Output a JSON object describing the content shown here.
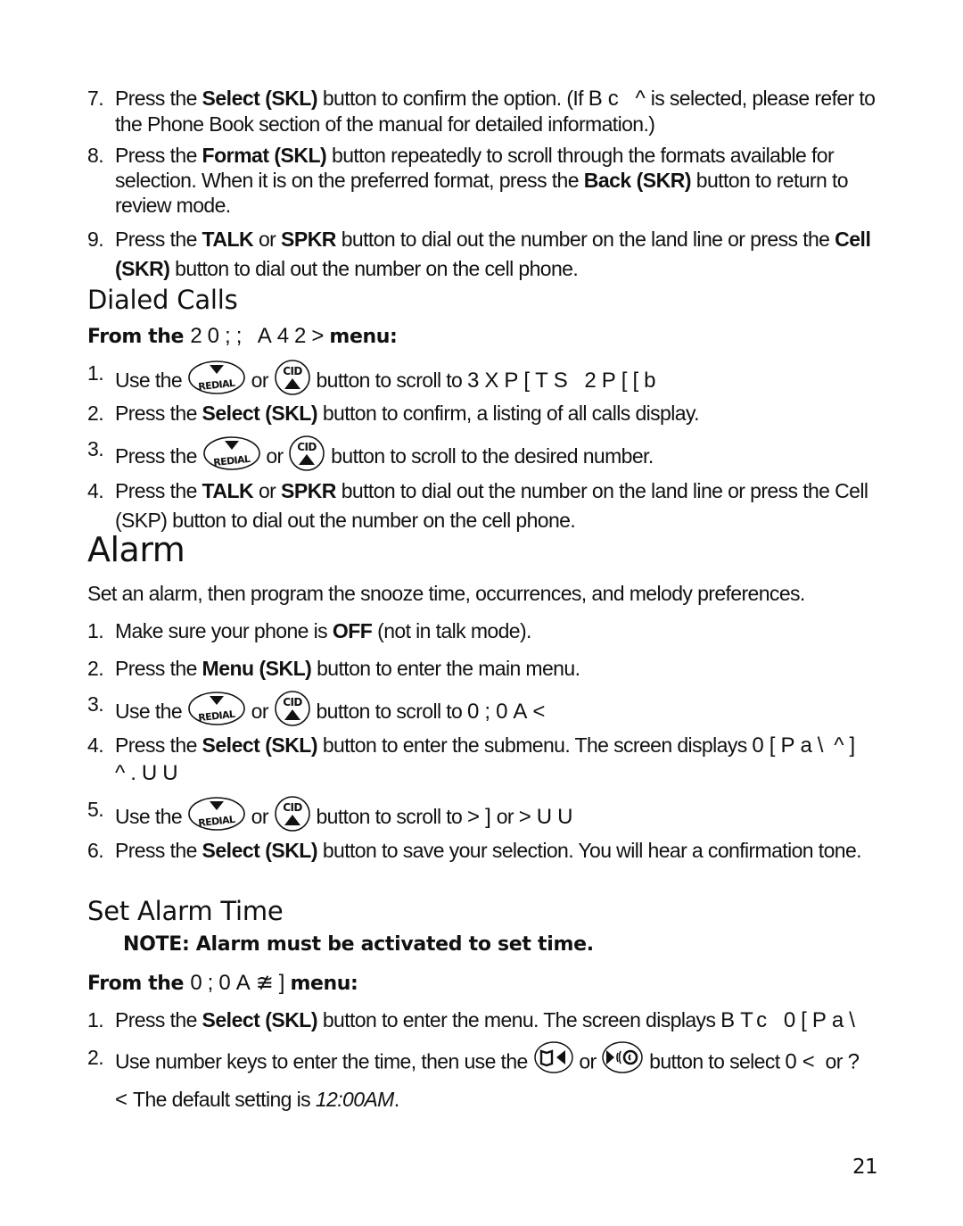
{
  "page_number": "21",
  "intro_steps": [
    {
      "num": "7.",
      "parts": [
        "Press the ",
        {
          "b": "Select (SKL)"
        },
        " button to confirm the option. (If ",
        {
          "g": "Bc ^"
        },
        "is selected, please refer to the Phone Book section of the manual for detailed information.)"
      ]
    },
    {
      "num": "8.",
      "parts": [
        "Press the ",
        {
          "b": "Format (SKL)"
        },
        " button repeatedly to scroll through the formats available for selection. When it is on the preferred format, press the ",
        {
          "b": "Back (SKR)"
        },
        " button to return to review mode."
      ]
    },
    {
      "num": "9.",
      "parts": [
        "Press the ",
        {
          "b": "TALK"
        },
        " or ",
        {
          "b": "SPKR"
        },
        " button to dial out the number on the land line or press the ",
        {
          "b": "Cell (SKR)"
        },
        " button to dial out the number on the cell phone."
      ]
    }
  ],
  "dialed_calls": {
    "heading": "Dialed Calls",
    "from_prefix": "From the ",
    "from_glyphs": "20;; A42>",
    "from_suffix": "menu:",
    "steps": [
      {
        "num": "1.",
        "parts": [
          "Use the ",
          {
            "icon": "redial"
          },
          " or ",
          {
            "icon": "cid"
          },
          " button to scroll to ",
          {
            "g": "3XP[TS 2P[[b"
          }
        ]
      },
      {
        "num": "2.",
        "parts": [
          "Press the ",
          {
            "b": "Select (SKL)"
          },
          " button to confirm, a listing of all calls display."
        ]
      },
      {
        "num": "3.",
        "parts": [
          "Press the ",
          {
            "icon": "redial"
          },
          " or ",
          {
            "icon": "cid"
          },
          " button to scroll to the desired number."
        ]
      },
      {
        "num": "4.",
        "parts": [
          "Press the ",
          {
            "b": "TALK"
          },
          " or ",
          {
            "b": "SPKR"
          },
          " button to dial out the number on the land line or press the Cell (SKP) button to dial out the number on the cell phone."
        ]
      }
    ]
  },
  "alarm": {
    "heading": "Alarm",
    "intro": "Set an alarm, then program the snooze time, occurrences, and melody preferences.",
    "steps": [
      {
        "num": "1.",
        "parts": [
          "Make sure your phone is ",
          {
            "b": "OFF"
          },
          " (not in talk mode)."
        ]
      },
      {
        "num": "2.",
        "parts": [
          "Press the ",
          {
            "b": "Menu (SKL)"
          },
          " button to enter the main menu."
        ]
      },
      {
        "num": "3.",
        "parts": [
          "Use the ",
          {
            "icon": "redial"
          },
          " or ",
          {
            "icon": "cid"
          },
          " button to scroll to ",
          {
            "g": "0;0A<"
          }
        ]
      },
      {
        "num": "4.",
        "parts": [
          "Press the ",
          {
            "b": "Select (SKL)"
          },
          " button to enter the submenu. The screen displays ",
          {
            "g": "0[Pa\\"
          },
          " ",
          {
            "g": "^] ^.UU"
          }
        ]
      },
      {
        "num": "5.",
        "parts": [
          "Use the ",
          {
            "icon": "redial"
          },
          " or ",
          {
            "icon": "cid"
          },
          " button to scroll to ",
          {
            "g": ">]"
          },
          "or ",
          {
            "g": ">UU"
          }
        ]
      },
      {
        "num": "6.",
        "parts": [
          "Press the ",
          {
            "b": "Select (SKL)"
          },
          " button to save your selection. You will hear a confirmation tone."
        ]
      }
    ]
  },
  "set_alarm_time": {
    "heading": "Set Alarm Time",
    "note": "NOTE: Alarm must be activated to set time.",
    "from_prefix": "From the ",
    "from_glyphs": "0;0A≇]",
    "from_suffix": "menu:",
    "steps": [
      {
        "num": "1.",
        "parts": [
          "Press the ",
          {
            "b": "Select (SKL)"
          },
          " button to enter the menu. The screen displays ",
          {
            "g": "BTc 0[Pa\\"
          }
        ]
      },
      {
        "num": "2.",
        "parts": [
          "Use number keys to enter the time, then use the ",
          {
            "icon": "phonebook-left"
          },
          " or ",
          {
            "icon": "right-speaker"
          },
          " button to select ",
          {
            "g": "0<"
          },
          " or ",
          {
            "g": "?<"
          },
          "The default setting is ",
          {
            "i": "12:00AM"
          },
          "."
        ]
      }
    ]
  },
  "icons": {
    "redial": {
      "name": "redial-down-icon",
      "label": "REDIAL"
    },
    "cid": {
      "name": "cid-up-icon",
      "label": "CID"
    },
    "phonebook-left": {
      "name": "phonebook-left-icon"
    },
    "right-speaker": {
      "name": "right-speaker-icon"
    }
  }
}
